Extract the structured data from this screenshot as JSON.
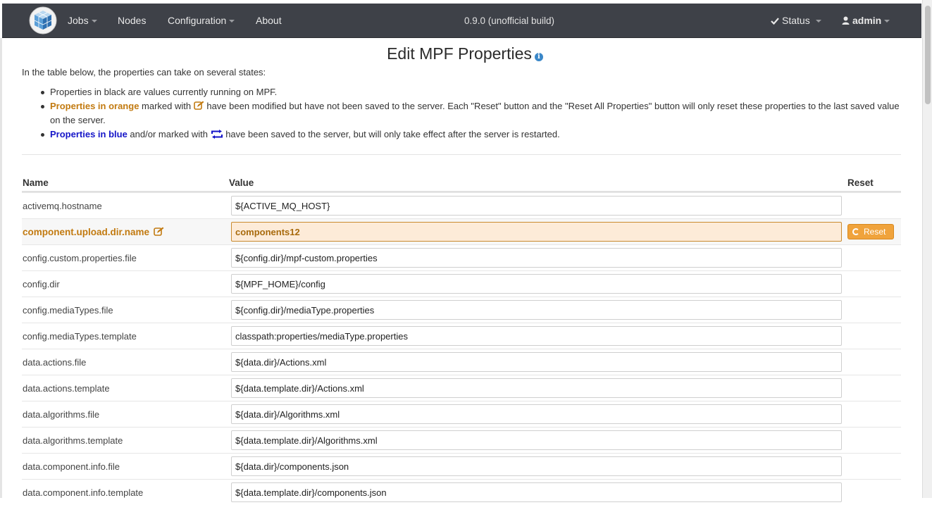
{
  "nav": {
    "jobs": "Jobs",
    "nodes": "Nodes",
    "configuration": "Configuration",
    "about": "About",
    "version": "0.9.0 (unofficial build)",
    "status": "Status",
    "user": "admin"
  },
  "page": {
    "title": "Edit MPF Properties",
    "intro": "In the table below, the properties can take on several states:",
    "bullet1": "Properties in black are values currently running on MPF.",
    "bullet2_strong": "Properties in orange",
    "bullet2_pre": " marked with ",
    "bullet2_rest": " have been modified but have not been saved to the server. Each \"Reset\" button and the \"Reset All Properties\" button will only reset these properties to the last saved value on the server.",
    "bullet3_strong": "Properties in blue",
    "bullet3_pre": " and/or marked with ",
    "bullet3_rest": " have been saved to the server, but will only take effect after the server is restarted."
  },
  "table": {
    "headers": {
      "name": "Name",
      "value": "Value",
      "reset": "Reset"
    },
    "reset_label": "Reset",
    "rows": [
      {
        "name": "activemq.hostname",
        "value": "${ACTIVE_MQ_HOST}",
        "modified": false
      },
      {
        "name": "component.upload.dir.name",
        "value": "components12",
        "modified": true
      },
      {
        "name": "config.custom.properties.file",
        "value": "${config.dir}/mpf-custom.properties",
        "modified": false
      },
      {
        "name": "config.dir",
        "value": "${MPF_HOME}/config",
        "modified": false
      },
      {
        "name": "config.mediaTypes.file",
        "value": "${config.dir}/mediaType.properties",
        "modified": false
      },
      {
        "name": "config.mediaTypes.template",
        "value": "classpath:properties/mediaType.properties",
        "modified": false
      },
      {
        "name": "data.actions.file",
        "value": "${data.dir}/Actions.xml",
        "modified": false
      },
      {
        "name": "data.actions.template",
        "value": "${data.template.dir}/Actions.xml",
        "modified": false
      },
      {
        "name": "data.algorithms.file",
        "value": "${data.dir}/Algorithms.xml",
        "modified": false
      },
      {
        "name": "data.algorithms.template",
        "value": "${data.template.dir}/Algorithms.xml",
        "modified": false
      },
      {
        "name": "data.component.info.file",
        "value": "${data.dir}/components.json",
        "modified": false
      },
      {
        "name": "data.component.info.template",
        "value": "${data.template.dir}/components.json",
        "modified": false
      }
    ]
  },
  "colors": {
    "navbar": "#3e4148",
    "orange": "#c27a10",
    "blue": "#1515c8",
    "reset_button": "#f0a33c"
  },
  "icons": [
    "logo-cube",
    "check-icon",
    "user-icon",
    "info-icon",
    "edit-icon",
    "restart-icon",
    "reset-icon"
  ]
}
